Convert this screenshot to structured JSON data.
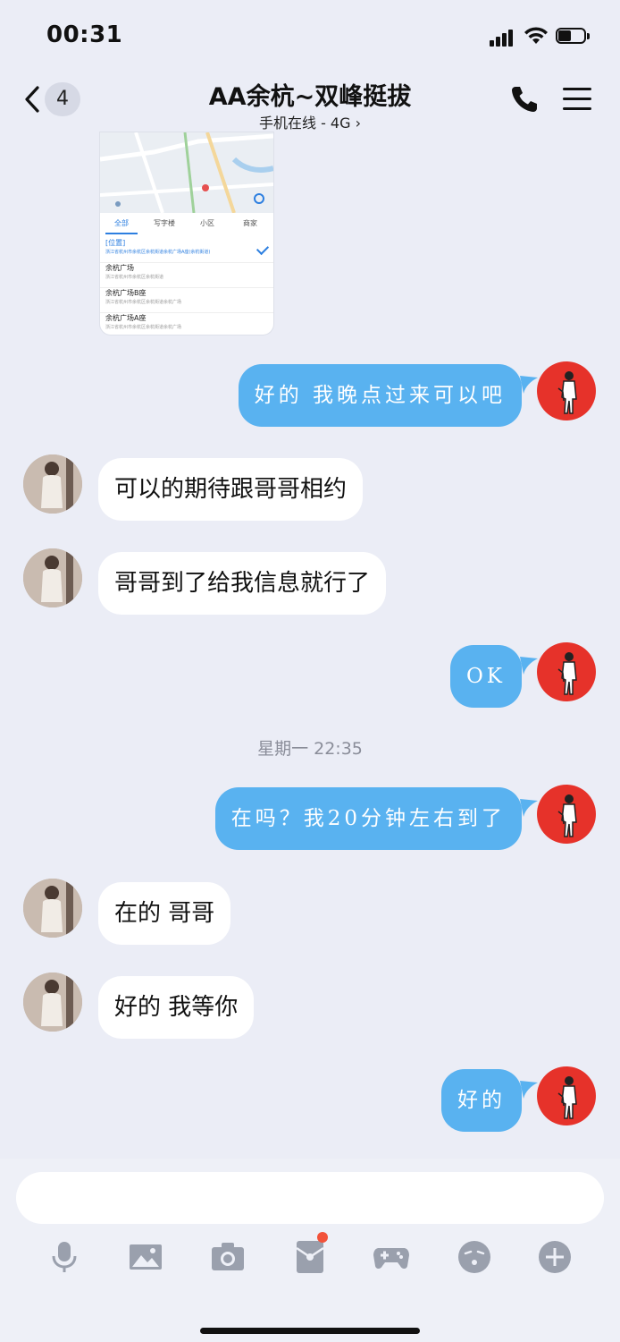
{
  "status_bar": {
    "time": "00:31"
  },
  "nav": {
    "back_count": "4",
    "title": "AA余杭~双峰挺拔",
    "subtitle": "手机在线 - 4G ›"
  },
  "location_card": {
    "tabs": [
      "全部",
      "写字楼",
      "小区",
      "商家"
    ],
    "items": [
      {
        "title": "[位置]",
        "desc": "浙江省杭州市余杭区余杭街道余杭广场A座(余杭街道)",
        "selected": true
      },
      {
        "title": "余杭广场",
        "desc": "浙江省杭州市余杭区余杭街道",
        "selected": false
      },
      {
        "title": "余杭广场B座",
        "desc": "浙江省杭州市余杭区余杭街道余杭广场",
        "selected": false
      },
      {
        "title": "余杭广场A座",
        "desc": "浙江省杭州市余杭区余杭街道余杭广场",
        "selected": false
      }
    ]
  },
  "messages": [
    {
      "from": "me",
      "text": "好的 我晚点过来可以吧"
    },
    {
      "from": "her",
      "text": "可以的期待跟哥哥相约"
    },
    {
      "from": "her",
      "text": "哥哥到了给我信息就行了"
    },
    {
      "from": "me",
      "text": "OK"
    },
    {
      "from": "me",
      "text": "在吗？我20分钟左右到了"
    },
    {
      "from": "her",
      "text": "在的 哥哥"
    },
    {
      "from": "her",
      "text": "好的 我等你"
    },
    {
      "from": "me",
      "text": "好的"
    }
  ],
  "time_divider": "星期一 22:35",
  "composer": {
    "tools": [
      "microphone-icon",
      "image-icon",
      "camera-icon",
      "red-packet-icon",
      "game-controller-icon",
      "emoji-icon",
      "plus-icon"
    ]
  },
  "colors": {
    "outgoing_bubble": "#59b2f0",
    "incoming_bubble": "#ffffff",
    "background": "#ebedf6",
    "notification_dot": "#f2523a",
    "avatar_me_bg": "#e6322a"
  }
}
